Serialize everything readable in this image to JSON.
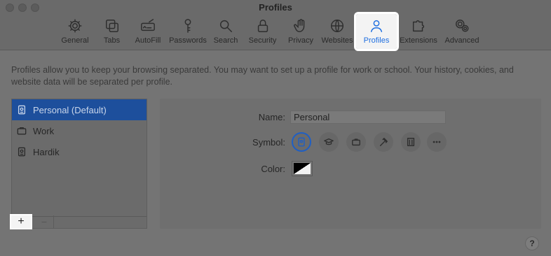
{
  "window": {
    "title": "Profiles"
  },
  "toolbar": {
    "items": [
      {
        "label": "General",
        "icon": "gear-icon"
      },
      {
        "label": "Tabs",
        "icon": "tabs-icon"
      },
      {
        "label": "AutoFill",
        "icon": "autofill-icon"
      },
      {
        "label": "Passwords",
        "icon": "key-icon"
      },
      {
        "label": "Search",
        "icon": "search-icon"
      },
      {
        "label": "Security",
        "icon": "lock-icon"
      },
      {
        "label": "Privacy",
        "icon": "hand-icon"
      },
      {
        "label": "Websites",
        "icon": "globe-icon"
      },
      {
        "label": "Profiles",
        "icon": "person-icon",
        "active": true
      },
      {
        "label": "Extensions",
        "icon": "puzzle-icon"
      },
      {
        "label": "Advanced",
        "icon": "gears-icon"
      }
    ]
  },
  "description": "Profiles allow you to keep your browsing separated. You may want to set up a profile for work or school. Your history, cookies, and website data will be separated per profile.",
  "profiles": {
    "items": [
      {
        "label": "Personal (Default)",
        "icon": "badge-icon",
        "selected": true
      },
      {
        "label": "Work",
        "icon": "briefcase-icon"
      },
      {
        "label": "Hardik",
        "icon": "badge-icon"
      }
    ],
    "add_label": "+",
    "remove_label": "−"
  },
  "detail": {
    "name_label": "Name:",
    "name_value": "Personal",
    "symbol_label": "Symbol:",
    "symbols": [
      "badge-icon",
      "graduation-cap-icon",
      "briefcase-icon",
      "hammer-icon",
      "building-icon",
      "more-icon"
    ],
    "color_label": "Color:"
  },
  "help_label": "?",
  "colors": {
    "accent": "#1f6fe0",
    "selection": "#1d4f9c"
  }
}
